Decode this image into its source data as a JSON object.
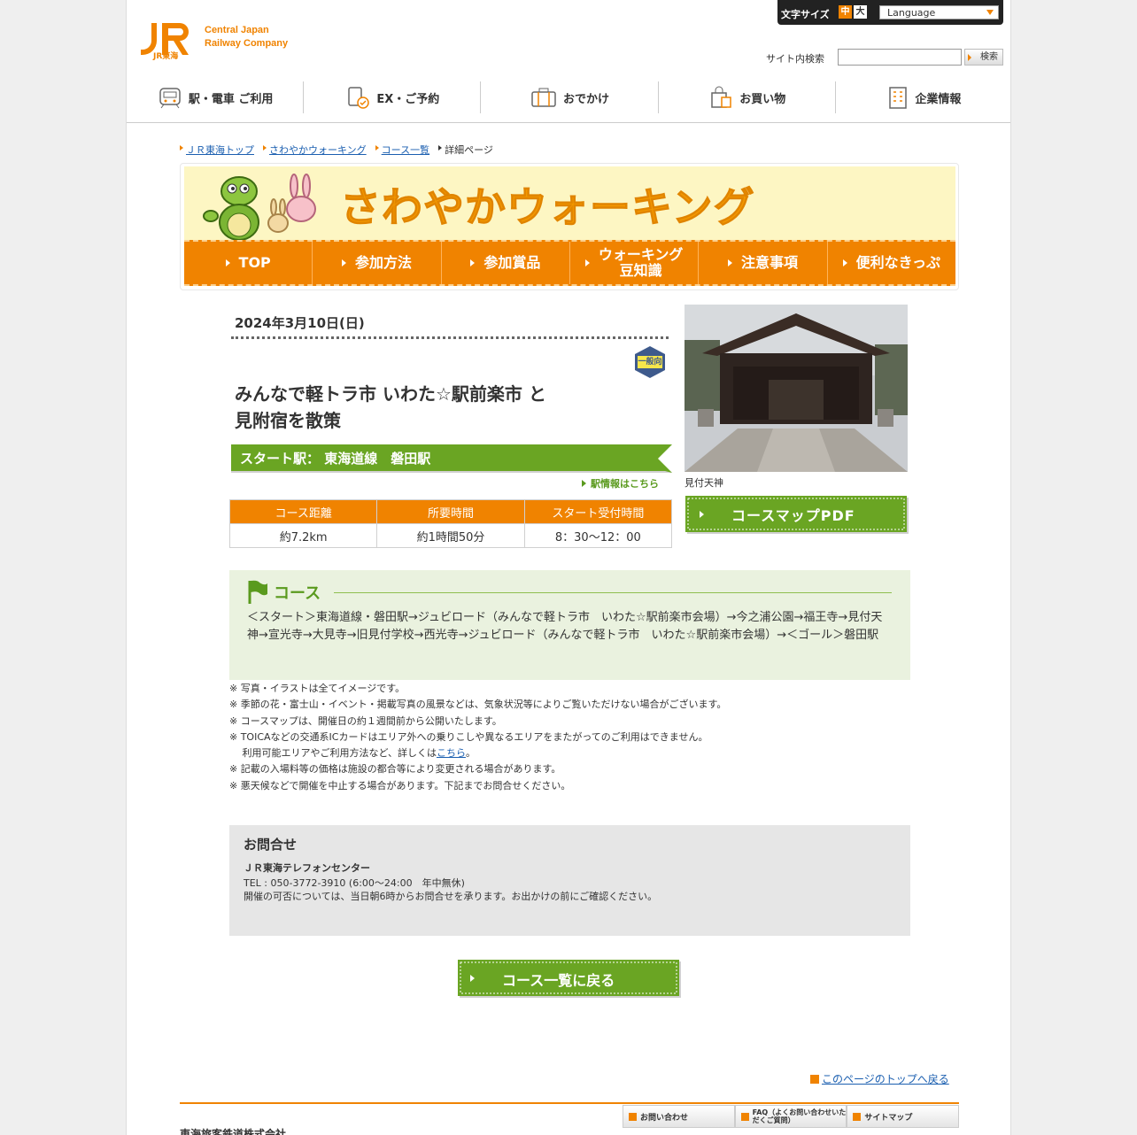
{
  "header": {
    "logo_line1": "Central Japan",
    "logo_line2": "Railway Company",
    "logo_sub": "JR東海",
    "fontsize_label": "文字サイズ",
    "fontsize_mid": "中",
    "fontsize_big": "大",
    "language": "Language",
    "search_label": "サイト内検索",
    "search_value": "",
    "search_button": "検索",
    "nav": [
      "駅・電車 ご利用",
      "EX・ご予約",
      "おでかけ",
      "お買い物",
      "企業情報"
    ]
  },
  "breadcrumb": [
    "ＪＲ東海トップ",
    "さわやかウォーキング",
    "コース一覧",
    "詳細ページ"
  ],
  "banner": {
    "title": "さわやかウォーキング",
    "nav": [
      "TOP",
      "参加方法",
      "参加賞品",
      "ウォーキング\n豆知識",
      "注意事項",
      "便利なきっぷ"
    ]
  },
  "event": {
    "date": "2024年3月10日(日)",
    "badge": "一般向",
    "title_line1": "みんなで軽トラ市 いわた☆駅前楽市 と",
    "title_line2": "見附宿を散策",
    "start_station": "スタート駅： 東海道線　磐田駅",
    "station_link": "駅情報はこちら",
    "table_headers": [
      "コース距離",
      "所要時間",
      "スタート受付時間"
    ],
    "table_values": [
      "約7.2km",
      "約1時間50分",
      "8：30〜12：00"
    ],
    "photo_caption": "見付天神",
    "pdf_button": "コースマップPDF"
  },
  "course": {
    "heading": "コース",
    "text": "＜スタート＞東海道線・磐田駅→ジュビロード（みんなで軽トラ市　いわた☆駅前楽市会場）→今之浦公園→福王寺→見付天神→宣光寺→大見寺→旧見付学校→西光寺→ジュビロード（みんなで軽トラ市　いわた☆駅前楽市会場）→＜ゴール＞磐田駅"
  },
  "notes": {
    "n1": "※ 写真・イラストは全てイメージです。",
    "n2": "※ 季節の花・富士山・イベント・掲載写真の風景などは、気象状況等によりご覧いただけない場合がございます。",
    "n3": "※ コースマップは、開催日の約１週間前から公開いたします。",
    "n4": "※ TOICAなどの交通系ICカードはエリア外への乗りこしや異なるエリアをまたがってのご利用はできません。",
    "n5_pre": "　 利用可能エリアやご利用方法など、詳しくは",
    "n5_link": "こちら",
    "n5_post": "。",
    "n6": "※ 記載の入場料等の価格は施設の都合等により変更される場合があります。",
    "n7": "※ 悪天候などで開催を中止する場合があります。下記までお問合せください。"
  },
  "contact": {
    "heading": "お問合せ",
    "center": "ＪＲ東海テレフォンセンター",
    "tel": "TEL : 050-3772-3910 (6:00〜24:00　年中無休)",
    "note": "開催の可否については、当日朝6時からお問合せを承ります。お出かけの前にご確認ください。"
  },
  "back_button": "コース一覧に戻る",
  "pagetop": "このページのトップへ戻る",
  "footer": {
    "nav": [
      "お問い合わせ",
      "FAQ（よくお問い合わせいただくご質問）",
      "サイトマップ"
    ],
    "company": "東海旅客鉄道株式会社"
  },
  "colors": {
    "accent": "#f08300",
    "green": "#6aa523",
    "link": "#1b5fb0",
    "banner_bg": "#fdf6c3"
  }
}
